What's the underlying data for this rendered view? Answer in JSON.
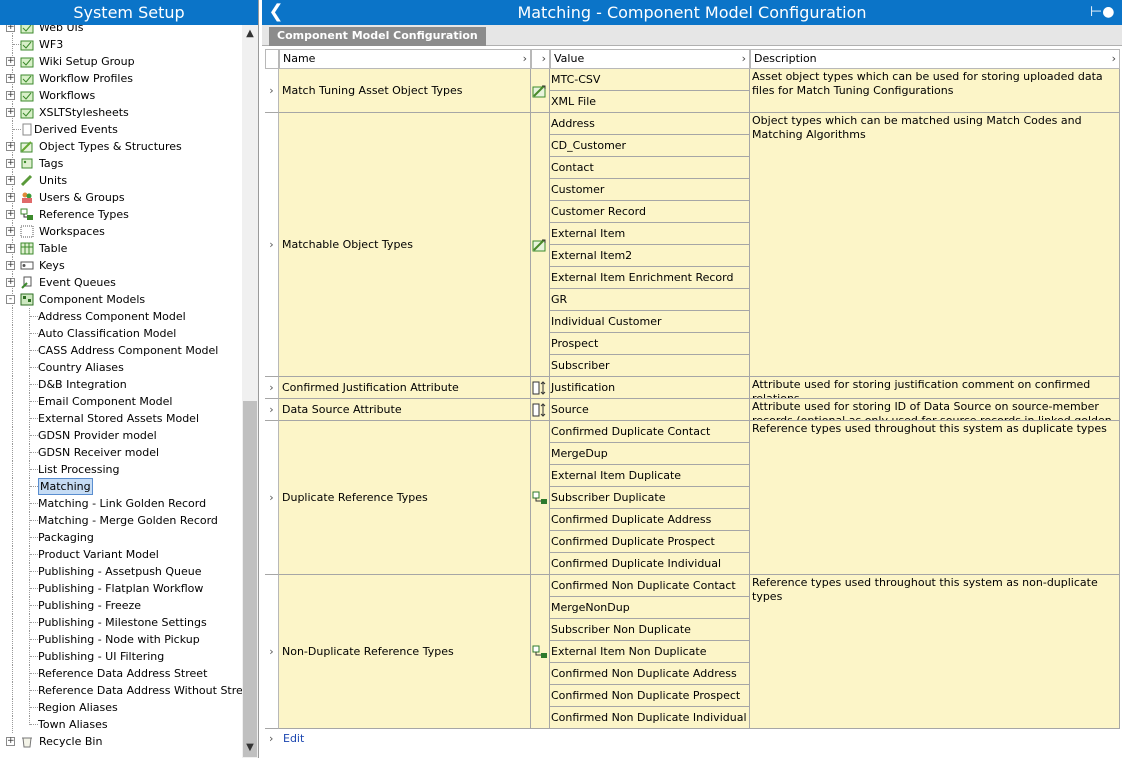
{
  "left_panel": {
    "title": "System Setup",
    "tree": [
      {
        "label": "Web UIs",
        "icon": "folder-icon",
        "level": 1,
        "expander": "+"
      },
      {
        "label": "WF3",
        "icon": "folder-icon",
        "level": 1,
        "expander": ""
      },
      {
        "label": "Wiki Setup Group",
        "icon": "folder-icon",
        "level": 1,
        "expander": "+"
      },
      {
        "label": "Workflow Profiles",
        "icon": "folder-icon",
        "level": 1,
        "expander": "+"
      },
      {
        "label": "Workflows",
        "icon": "folder-icon",
        "level": 1,
        "expander": "+"
      },
      {
        "label": "XSLTStylesheets",
        "icon": "folder-icon",
        "level": 1,
        "expander": "+"
      },
      {
        "label": "Derived Events",
        "icon": "document-icon",
        "level": 1,
        "expander": ""
      },
      {
        "label": "Object Types & Structures",
        "icon": "object-types-icon",
        "level": 1,
        "expander": "+"
      },
      {
        "label": "Tags",
        "icon": "tags-icon",
        "level": 1,
        "expander": "+"
      },
      {
        "label": "Units",
        "icon": "units-icon",
        "level": 1,
        "expander": "+"
      },
      {
        "label": "Users & Groups",
        "icon": "users-icon",
        "level": 1,
        "expander": "+"
      },
      {
        "label": "Reference Types",
        "icon": "reference-types-icon",
        "level": 1,
        "expander": "+"
      },
      {
        "label": "Workspaces",
        "icon": "workspaces-icon",
        "level": 1,
        "expander": "+"
      },
      {
        "label": "Table",
        "icon": "table-icon",
        "level": 1,
        "expander": "+"
      },
      {
        "label": "Keys",
        "icon": "keys-icon",
        "level": 1,
        "expander": "+"
      },
      {
        "label": "Event Queues",
        "icon": "event-queues-icon",
        "level": 1,
        "expander": "+"
      },
      {
        "label": "Component Models",
        "icon": "component-models-icon",
        "level": 1,
        "expander": "-"
      },
      {
        "label": "Address Component Model",
        "level": 2
      },
      {
        "label": "Auto Classification Model",
        "level": 2
      },
      {
        "label": "CASS Address Component Model",
        "level": 2
      },
      {
        "label": "Country Aliases",
        "level": 2
      },
      {
        "label": "D&B Integration",
        "level": 2
      },
      {
        "label": "Email Component Model",
        "level": 2
      },
      {
        "label": "External Stored Assets Model",
        "level": 2
      },
      {
        "label": "GDSN Provider model",
        "level": 2
      },
      {
        "label": "GDSN Receiver model",
        "level": 2
      },
      {
        "label": "List Processing",
        "level": 2
      },
      {
        "label": "Matching",
        "level": 2,
        "selected": true
      },
      {
        "label": "Matching - Link Golden Record",
        "level": 2
      },
      {
        "label": "Matching - Merge Golden Record",
        "level": 2
      },
      {
        "label": "Packaging",
        "level": 2
      },
      {
        "label": "Product Variant Model",
        "level": 2
      },
      {
        "label": "Publishing - Assetpush Queue",
        "level": 2
      },
      {
        "label": "Publishing - Flatplan Workflow",
        "level": 2
      },
      {
        "label": "Publishing - Freeze",
        "level": 2
      },
      {
        "label": "Publishing - Milestone Settings",
        "level": 2
      },
      {
        "label": "Publishing - Node with Pickup",
        "level": 2
      },
      {
        "label": "Publishing - UI Filtering",
        "level": 2
      },
      {
        "label": "Reference Data Address Street",
        "level": 2
      },
      {
        "label": "Reference Data Address Without Street",
        "level": 2
      },
      {
        "label": "Region Aliases",
        "level": 2
      },
      {
        "label": "Town Aliases",
        "level": 2
      },
      {
        "label": "Recycle Bin",
        "icon": "recycle-bin-icon",
        "level": 0,
        "expander": "+"
      }
    ]
  },
  "right_panel": {
    "title": "Matching - Component Model Configuration",
    "tab_label": "Component Model Configuration",
    "columns": {
      "name": "Name",
      "value": "Value",
      "description": "Description"
    },
    "rows": [
      {
        "name": "Match Tuning Asset Object Types",
        "icon": "object-type-icon",
        "values": [
          "MTC-CSV",
          "XML File"
        ],
        "description": "Asset object types which can be used for storing uploaded data files for Match Tuning Configurations"
      },
      {
        "name": "Matchable Object Types",
        "icon": "object-type-icon",
        "values": [
          "Address",
          "CD_Customer",
          "Contact",
          "Customer",
          "Customer Record",
          "External Item",
          "External Item2",
          "External Item Enrichment Record",
          "GR",
          "Individual Customer",
          "Prospect",
          "Subscriber"
        ],
        "description": "Object types which can be matched using Match Codes and Matching Algorithms"
      },
      {
        "name": "Confirmed Justification Attribute",
        "icon": "attribute-icon",
        "values": [
          "Justification"
        ],
        "description": "Attribute used for storing justification comment on confirmed relations"
      },
      {
        "name": "Data Source Attribute",
        "icon": "attribute-icon",
        "values": [
          "Source"
        ],
        "description": "Attribute used for storing ID of Data Source on source-member records (optional as only used for source records in linked golden records setup)"
      },
      {
        "name": "Duplicate Reference Types",
        "icon": "reference-type-icon",
        "values": [
          "Confirmed Duplicate Contact",
          "MergeDup",
          "External Item Duplicate",
          "Subscriber Duplicate",
          "Confirmed Duplicate Address",
          "Confirmed Duplicate Prospect",
          "Confirmed Duplicate Individual"
        ],
        "description": "Reference types used throughout this system as duplicate types"
      },
      {
        "name": "Non-Duplicate Reference Types",
        "icon": "reference-type-icon",
        "values": [
          "Confirmed Non Duplicate Contact",
          "MergeNonDup",
          "Subscriber Non Duplicate",
          "External Item Non Duplicate",
          "Confirmed Non Duplicate Address",
          "Confirmed Non Duplicate Prospect",
          "Confirmed Non Duplicate Individual"
        ],
        "description": "Reference types used throughout this system as non-duplicate types"
      }
    ],
    "edit_label": "Edit"
  },
  "colors": {
    "header_blue": "#0b74c8",
    "cell_yellow": "#fcf5c8",
    "selection": "#c6dcf4",
    "link": "#1b46b0"
  }
}
